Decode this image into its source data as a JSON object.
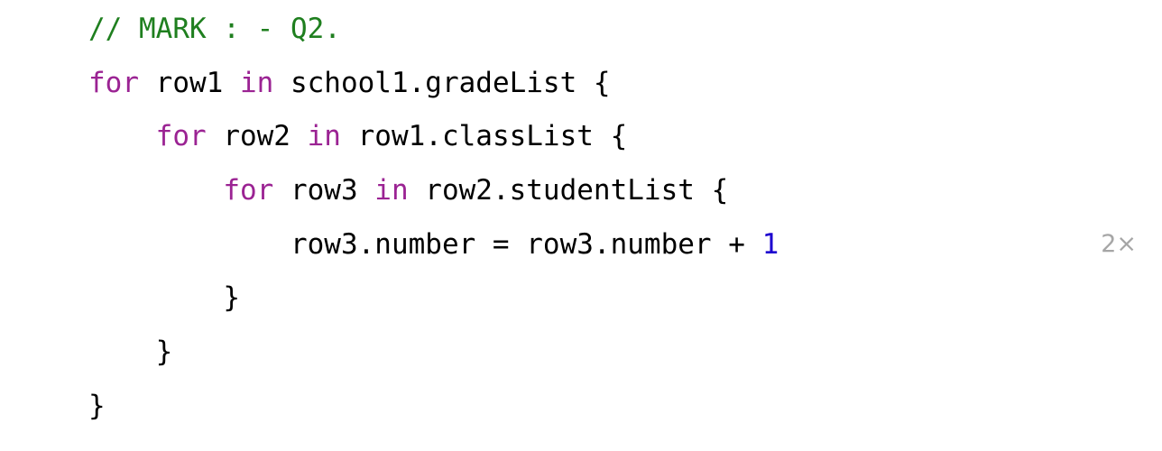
{
  "editor": {
    "lines": [
      {
        "indent": "",
        "tokens": [
          {
            "t": "comment",
            "v": "// MARK : - Q2."
          }
        ]
      },
      {
        "indent": "",
        "tokens": [
          {
            "t": "keyword",
            "v": "for"
          },
          {
            "t": "plain",
            "v": " row1 "
          },
          {
            "t": "keyword",
            "v": "in"
          },
          {
            "t": "plain",
            "v": " school1.gradeList {"
          }
        ]
      },
      {
        "indent": "    ",
        "tokens": [
          {
            "t": "keyword",
            "v": "for"
          },
          {
            "t": "plain",
            "v": " row2 "
          },
          {
            "t": "keyword",
            "v": "in"
          },
          {
            "t": "plain",
            "v": " row1.classList {"
          }
        ]
      },
      {
        "indent": "        ",
        "tokens": [
          {
            "t": "keyword",
            "v": "for"
          },
          {
            "t": "plain",
            "v": " row3 "
          },
          {
            "t": "keyword",
            "v": "in"
          },
          {
            "t": "plain",
            "v": " row2.studentList {"
          }
        ]
      },
      {
        "indent": "            ",
        "tokens": [
          {
            "t": "plain",
            "v": "row3.number = row3.number + "
          },
          {
            "t": "number",
            "v": "1"
          }
        ]
      },
      {
        "indent": "        ",
        "tokens": [
          {
            "t": "plain",
            "v": "}"
          }
        ]
      },
      {
        "indent": "    ",
        "tokens": [
          {
            "t": "plain",
            "v": "}"
          }
        ]
      },
      {
        "indent": "",
        "tokens": [
          {
            "t": "plain",
            "v": "}"
          }
        ]
      }
    ],
    "execution_count": "2×",
    "execution_count_line": 4
  },
  "colors": {
    "comment": "#1f7f1f",
    "keyword": "#9b2393",
    "number": "#1c00cf",
    "plain": "#000000",
    "annotation": "#a6a6a6"
  }
}
